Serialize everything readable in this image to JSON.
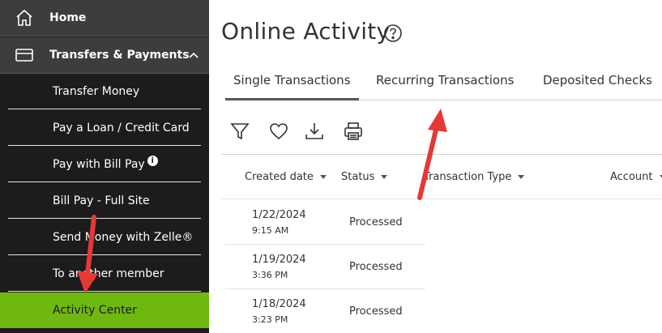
{
  "sidebar": {
    "home_label": "Home",
    "transfers_label": "Transfers & Payments",
    "items": [
      {
        "label": "Transfer Money"
      },
      {
        "label": "Pay a Loan / Credit Card"
      },
      {
        "label": "Pay with Bill Pay"
      },
      {
        "label": "Bill Pay - Full Site"
      },
      {
        "label": "Send Money with Zelle®"
      },
      {
        "label": "To another member"
      },
      {
        "label": "Activity Center"
      }
    ],
    "info_glyph": "i"
  },
  "main": {
    "title": "Online Activity",
    "tabs": [
      {
        "label": "Single Transactions"
      },
      {
        "label": "Recurring Transactions"
      },
      {
        "label": "Deposited Checks"
      }
    ],
    "toolbar_icons": [
      "filter-icon",
      "heart-icon",
      "download-icon",
      "print-icon"
    ],
    "columns": [
      {
        "label": "Created date"
      },
      {
        "label": "Status"
      },
      {
        "label": "Transaction Type"
      },
      {
        "label": "Account"
      }
    ],
    "rows": [
      {
        "date": "1/22/2024",
        "time": "9:15 AM",
        "status": "Processed"
      },
      {
        "date": "1/19/2024",
        "time": "3:36 PM",
        "status": "Processed"
      },
      {
        "date": "1/18/2024",
        "time": "3:23 PM",
        "status": "Processed"
      }
    ]
  },
  "colors": {
    "sidebar_bg": "#1c1c1c",
    "sidebar_header_bg": "#3d3d3d",
    "active_item_bg": "#6fb811",
    "annotation_arrow": "#e53935"
  }
}
